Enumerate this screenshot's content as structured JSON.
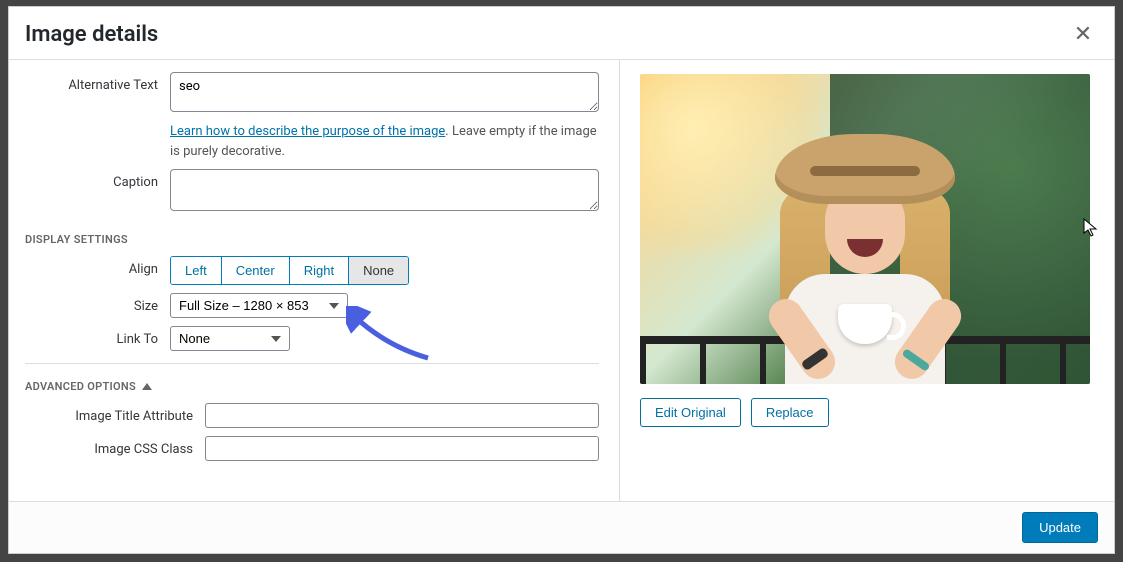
{
  "modal": {
    "title": "Image details",
    "close_glyph": "✕"
  },
  "fields": {
    "alt_text": {
      "label": "Alternative Text",
      "value": "seo"
    },
    "alt_help": {
      "link_text": "Learn how to describe the purpose of the image",
      "suffix": ". Leave empty if the image is purely decorative."
    },
    "caption": {
      "label": "Caption",
      "value": ""
    },
    "display_settings_head": "DISPLAY SETTINGS",
    "align": {
      "label": "Align",
      "options": [
        "Left",
        "Center",
        "Right",
        "None"
      ],
      "selected": "None"
    },
    "size": {
      "label": "Size",
      "selected": "Full Size – 1280 × 853"
    },
    "link_to": {
      "label": "Link To",
      "selected": "None"
    },
    "advanced_head": "ADVANCED OPTIONS",
    "image_title_attr": {
      "label": "Image Title Attribute",
      "value": ""
    },
    "image_css_class": {
      "label": "Image CSS Class",
      "value": ""
    }
  },
  "preview": {
    "edit_original": "Edit Original",
    "replace": "Replace"
  },
  "footer": {
    "update": "Update"
  }
}
